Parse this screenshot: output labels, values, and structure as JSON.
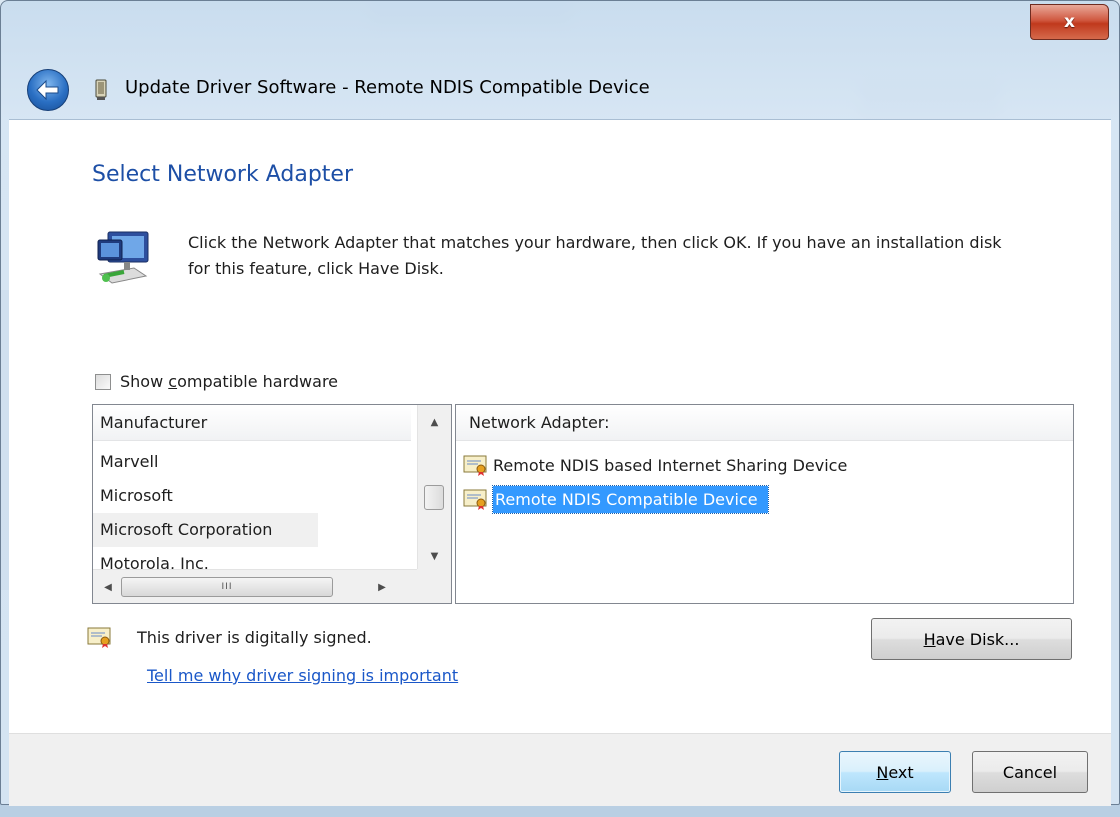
{
  "window": {
    "title": "Update Driver Software - Remote NDIS Compatible Device",
    "close_label": "x"
  },
  "page": {
    "heading": "Select Network Adapter",
    "description": "Click the Network Adapter that matches your hardware, then click OK. If you have an installation disk for this feature, click Have Disk."
  },
  "compatible": {
    "label_pre": "Show ",
    "label_accel": "c",
    "label_post": "ompatible hardware",
    "checked": false
  },
  "manufacturer_list": {
    "header": "Manufacturer",
    "items": [
      "Marvell",
      "Microsoft",
      "Microsoft Corporation",
      "Motorola, Inc."
    ],
    "selected": "Microsoft Corporation",
    "scroll_thumb_glyph": "III"
  },
  "adapter_list": {
    "header": "Network Adapter:",
    "items": [
      "Remote NDIS based Internet Sharing Device",
      "Remote NDIS Compatible Device"
    ],
    "selected": "Remote NDIS Compatible Device"
  },
  "signing": {
    "status": "This driver is digitally signed.",
    "link": "Tell me why driver signing is important"
  },
  "buttons": {
    "have_disk_accel": "H",
    "have_disk_rest": "ave Disk...",
    "next_accel": "N",
    "next_rest": "ext",
    "cancel": "Cancel"
  },
  "colors": {
    "heading": "#1d4fa6",
    "selection": "#3399ff",
    "link": "#1a57c8",
    "close": "#c0391d"
  },
  "icons": [
    "back-arrow-icon",
    "device-icon",
    "network-adapter-icon",
    "certificate-icon"
  ]
}
